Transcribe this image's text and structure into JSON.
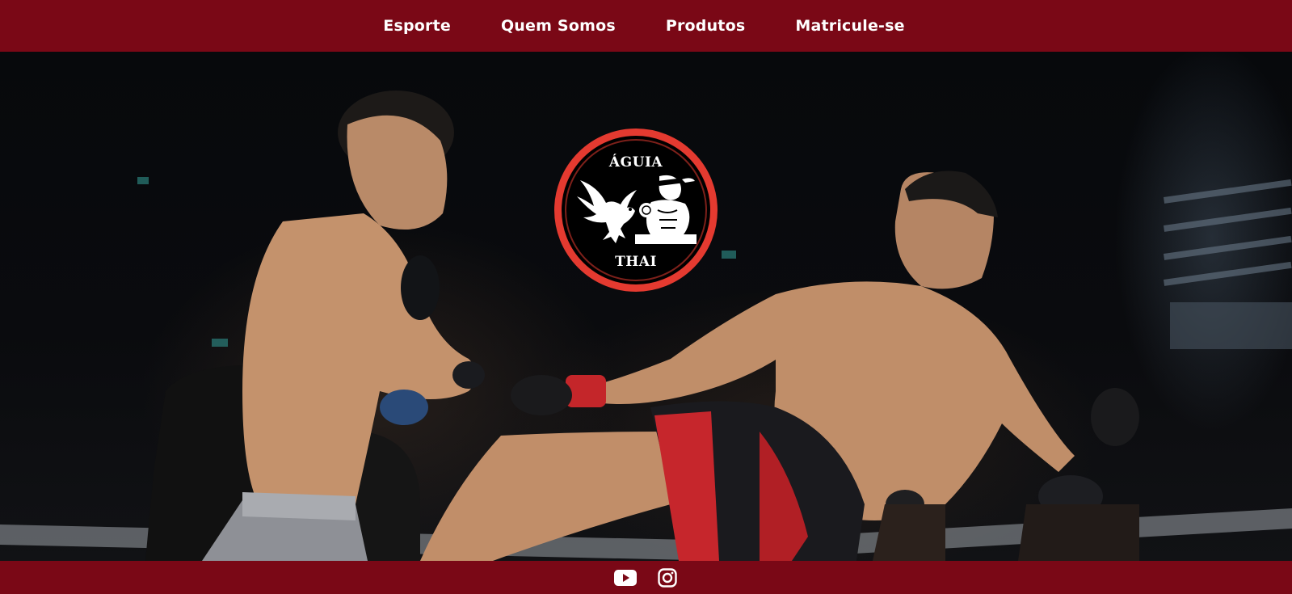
{
  "nav": {
    "items": [
      {
        "label": "Esporte"
      },
      {
        "label": "Quem Somos"
      },
      {
        "label": "Produtos"
      },
      {
        "label": "Matricule-se"
      }
    ]
  },
  "logo": {
    "top_text": "ÁGUIA",
    "bottom_text": "THAI"
  },
  "footer": {
    "social": [
      {
        "icon": "youtube-icon"
      },
      {
        "icon": "instagram-icon"
      }
    ]
  },
  "colors": {
    "brand": "#7a0816",
    "logo_ring": "#e43a30"
  }
}
